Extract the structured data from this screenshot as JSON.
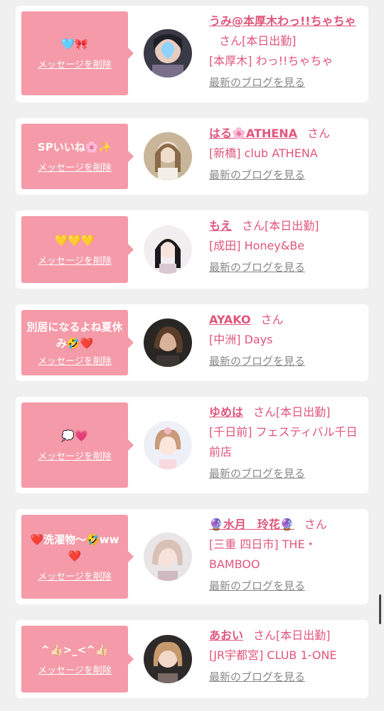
{
  "common": {
    "delete_label": "メッセージを削除",
    "san": "さん",
    "blog_label": "最新のブログを見る"
  },
  "colors": {
    "bubble": "#f59aa8",
    "name": "#e0567b",
    "blog": "#888888",
    "background": "#f0f0f0"
  },
  "items": [
    {
      "message": "🩵🎀",
      "name": "うみ@本厚木わっ!!ちゃちゃ",
      "status": "[本日出勤]",
      "shop": "[本厚木] わっ!!ちゃちゃ"
    },
    {
      "message": "SPいいね🌸✨",
      "name": "はる🌸ATHENA",
      "status": "",
      "shop": "[新橋] club ATHENA"
    },
    {
      "message": "💛💛💛",
      "name": "もえ",
      "status": "[本日出勤]",
      "shop": "[成田] Honey&Be"
    },
    {
      "message": "別居になるよね夏休み🤣❤️",
      "name": "AYAKO",
      "status": "",
      "shop": "[中洲] Days"
    },
    {
      "message": "💭💗",
      "name": "ゆめは",
      "status": "[本日出勤]",
      "shop": "[千日前] フェスティバル千日前店"
    },
    {
      "message": "❤️洗濯物〜🤣ww❤️",
      "name": "🔮水月　玲花🔮",
      "status": "",
      "shop": "[三重 四日市] THE・BAMBOO"
    },
    {
      "message": "^👍🏻>_<^👍🏻",
      "name": "あおい",
      "status": "[本日出勤]",
      "shop": "[JR宇都宮] CLUB 1-ONE"
    }
  ]
}
